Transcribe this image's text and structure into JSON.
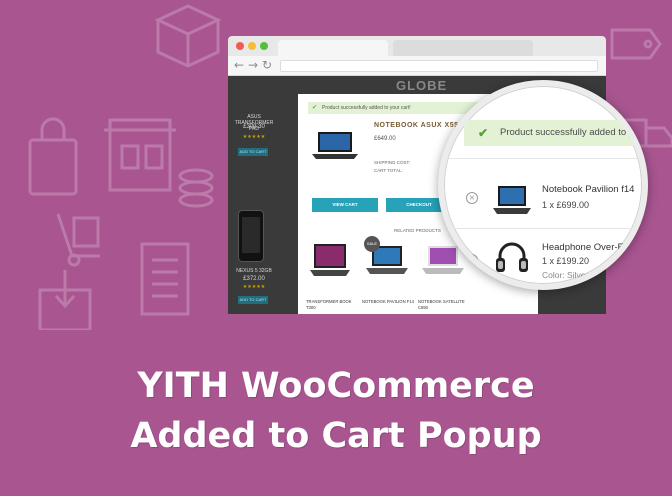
{
  "background_color": "#a85590",
  "accent_color": "#27a2b8",
  "success_color": "#e3f2d5",
  "browser": {
    "site_logo": "GLOBE",
    "side_products": [
      {
        "name": "ASUS TRANSFORMER PAD",
        "price": "£309.30",
        "button": "ADD TO CART"
      },
      {
        "name": "NEXUS 5 32GB",
        "price": "£372.00",
        "button": "ADD TO CART"
      }
    ]
  },
  "popup": {
    "success_message": "Product successfully added to your cart!",
    "product_title": "NOTEBOOK ASUX X55",
    "product_price": "£649.00",
    "shipping_label": "SHIPPING COST:",
    "total_label": "CART TOTAL:",
    "view_cart_label": "VIEW CART",
    "checkout_label": "CHECKOUT",
    "related_label": "RELATED PRODUCTS",
    "related_products": [
      {
        "name": "TRANSFORMER BOOK T300"
      },
      {
        "name": "NOTEBOOK PAVILION F14",
        "badge": "SALE"
      },
      {
        "name": "NOTEBOOK SATELLITE C650"
      }
    ]
  },
  "magnifier": {
    "success_message": "Product successfully added to you",
    "items": [
      {
        "name": "Notebook Pavilion f14",
        "qty_price": "1 x £699.00",
        "icon": "laptop-icon"
      },
      {
        "name": "Headphone Over-E",
        "qty_price": "1 x £199.20",
        "color": "Color: Silver",
        "icon": "headphone-icon"
      }
    ]
  },
  "headline": {
    "line1": "YITH WooCommerce",
    "line2": "Added to Cart Popup"
  }
}
